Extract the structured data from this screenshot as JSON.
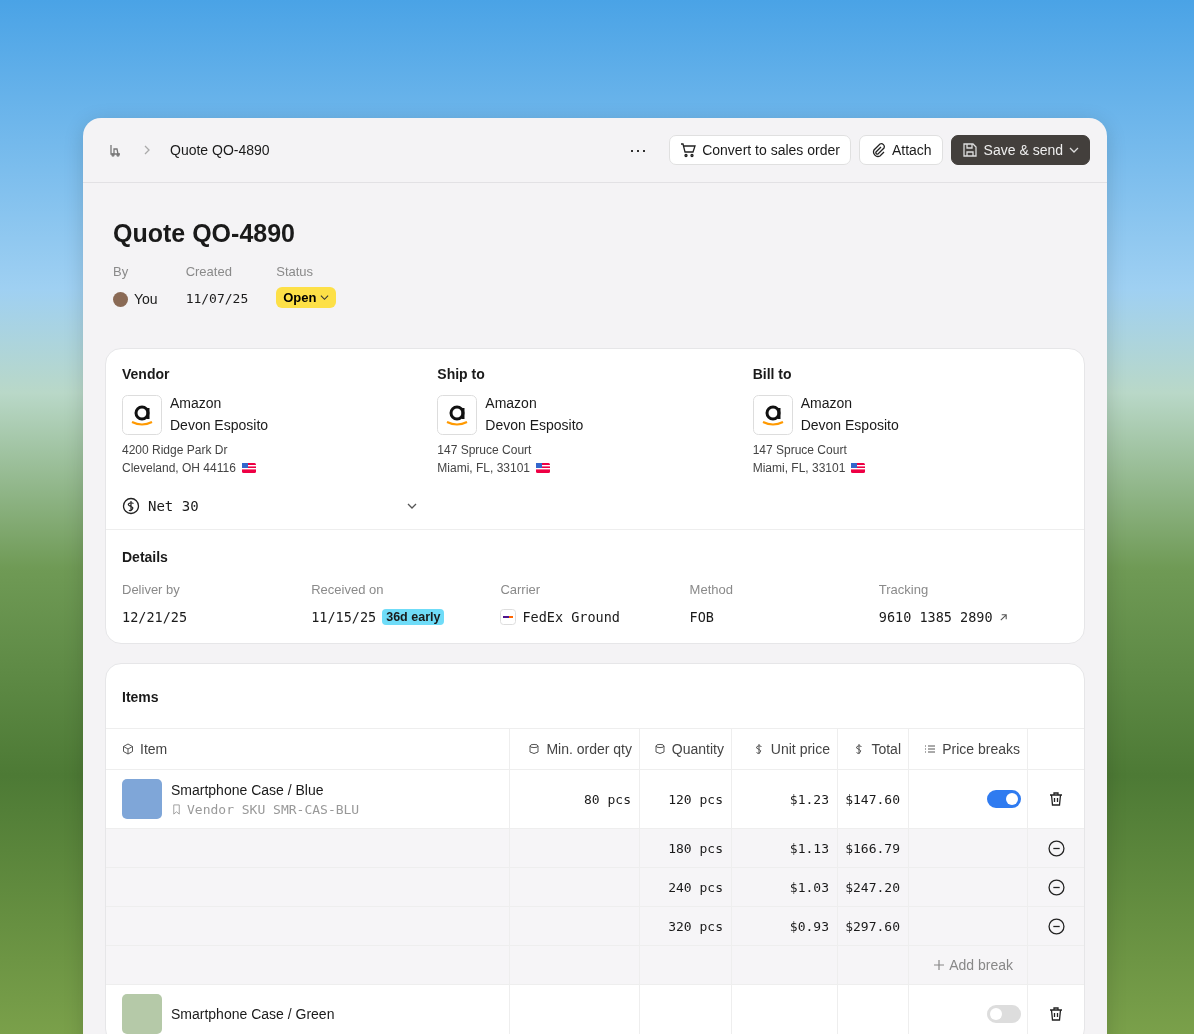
{
  "header": {
    "breadcrumb": "Quote QO-4890",
    "more_label": "⋯",
    "buttons": [
      {
        "kind": "convert",
        "label": "Convert to sales order"
      },
      {
        "kind": "attach",
        "label": "Attach"
      },
      {
        "kind": "save",
        "label": "Save & send"
      }
    ]
  },
  "title": "Quote QO-4890",
  "meta": {
    "by_label": "By",
    "by_value": "You",
    "created_label": "Created",
    "created_value": "11/07/25",
    "status_label": "Status",
    "status_value": "Open"
  },
  "parties": [
    {
      "heading": "Vendor",
      "company": "Amazon",
      "contact": "Devon Esposito",
      "address_line_1": "4200 Ridge Park Dr",
      "address_line_2": "Cleveland, OH 44116"
    },
    {
      "heading": "Ship to",
      "company": "Amazon",
      "contact": "Devon Esposito",
      "address_line_1": "147 Spruce Court",
      "address_line_2": "Miami, FL, 33101"
    },
    {
      "heading": "Bill to",
      "company": "Amazon",
      "contact": "Devon Esposito",
      "address_line_1": "147 Spruce Court",
      "address_line_2": "Miami, FL, 33101"
    }
  ],
  "payment_terms": "Net 30",
  "details": {
    "heading": "Details",
    "fields": [
      {
        "kind": "text",
        "label": "Deliver by",
        "value": "12/21/25"
      },
      {
        "kind": "badge",
        "label": "Received on",
        "value": "11/15/25",
        "badge": "36d early"
      },
      {
        "kind": "carrier",
        "label": "Carrier",
        "value": "FedEx Ground"
      },
      {
        "kind": "text",
        "label": "Method",
        "value": "FOB"
      },
      {
        "kind": "link",
        "label": "Tracking",
        "value": "9610 1385 2890"
      }
    ]
  },
  "items": {
    "heading": "Items",
    "columns": [
      {
        "kind": "cube",
        "label": "Item"
      },
      {
        "kind": "cylinder",
        "label": "Min. order qty"
      },
      {
        "kind": "cylinder",
        "label": "Quantity"
      },
      {
        "kind": "dollar",
        "label": "Unit price"
      },
      {
        "kind": "dollar",
        "label": "Total"
      },
      {
        "kind": "list",
        "label": "Price breaks"
      }
    ],
    "rows": [
      {
        "name": "Smartphone Case / Blue",
        "sku": "Vendor SKU SMR-CAS-BLU",
        "min_qty": "80 pcs",
        "quantity": "120 pcs",
        "unit_price": "$1.23",
        "total": "$147.60",
        "price_breaks_on": true,
        "breaks": [
          {
            "quantity": "180 pcs",
            "unit_price": "$1.13",
            "total": "$166.79"
          },
          {
            "quantity": "240 pcs",
            "unit_price": "$1.03",
            "total": "$247.20"
          },
          {
            "quantity": "320 pcs",
            "unit_price": "$0.93",
            "total": "$297.60"
          }
        ],
        "add_break_label": "Add break"
      },
      {
        "name": "Smartphone Case / Green",
        "price_breaks_on": false
      }
    ]
  }
}
